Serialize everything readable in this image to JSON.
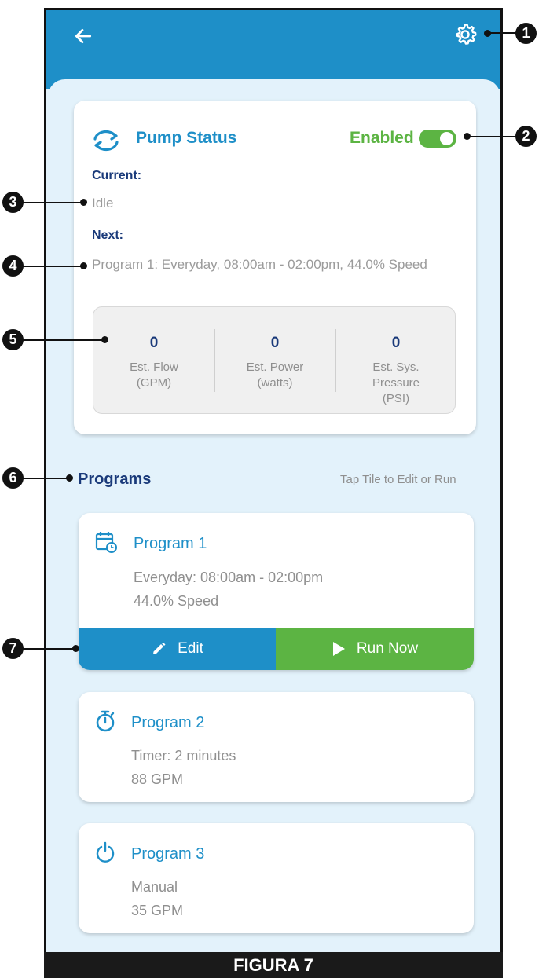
{
  "header": {
    "back_icon": "arrow-left-icon",
    "settings_icon": "gear-icon",
    "color": "#1e8fc8"
  },
  "pump_status": {
    "title": "Pump Status",
    "status_label": "Enabled",
    "enabled": true,
    "current_label": "Current:",
    "current_value": "Idle",
    "next_label": "Next:",
    "next_value": "Program 1: Everyday, 08:00am - 02:00pm, 44.0% Speed",
    "stats": [
      {
        "value": "0",
        "label": "Est. Flow\n(GPM)"
      },
      {
        "value": "0",
        "label": "Est. Power\n(watts)"
      },
      {
        "value": "0",
        "label": "Est. Sys.\nPressure\n(PSI)"
      }
    ]
  },
  "programs": {
    "title": "Programs",
    "hint": "Tap Tile to Edit or Run",
    "items": [
      {
        "name": "Program 1",
        "line1": "Everyday: 08:00am - 02:00pm",
        "line2": "44.0% Speed",
        "icon": "calendar-clock-icon"
      },
      {
        "name": "Program 2",
        "line1": "Timer: 2 minutes",
        "line2": "88 GPM",
        "icon": "stopwatch-icon"
      },
      {
        "name": "Program 3",
        "line1": "Manual",
        "line2": "35 GPM",
        "icon": "power-icon"
      }
    ],
    "edit_label": "Edit",
    "run_label": "Run Now"
  },
  "callouts": [
    "1",
    "2",
    "3",
    "4",
    "5",
    "6",
    "7"
  ],
  "footer": "FIGURA 7",
  "colors": {
    "accent": "#1e8fc8",
    "green": "#5cb443",
    "navy": "#1a3a7a"
  }
}
